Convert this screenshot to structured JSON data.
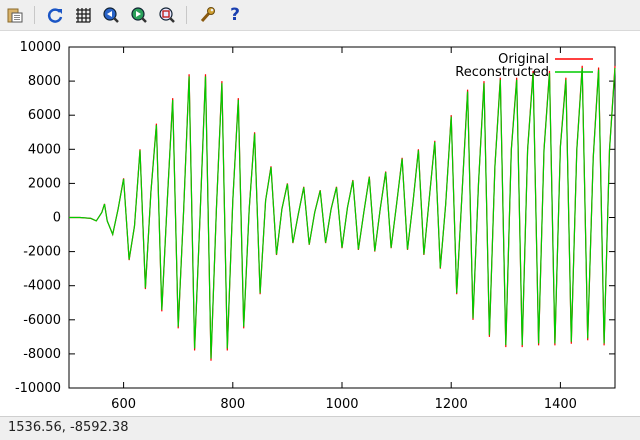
{
  "toolbar": {
    "icons": [
      "copy-to-clipboard-icon",
      "replot-icon",
      "grid-icon",
      "zoom-previous-icon",
      "zoom-next-icon",
      "unzoom-icon",
      "options-icon",
      "help-icon"
    ]
  },
  "status": {
    "coords": "1536.56, -8592.38"
  },
  "chart_data": {
    "type": "line",
    "title": "",
    "xlabel": "",
    "ylabel": "",
    "xlim": [
      500,
      1500
    ],
    "ylim": [
      -10000,
      10000
    ],
    "xticks": [
      600,
      800,
      1000,
      1200,
      1400
    ],
    "yticks": [
      -10000,
      -8000,
      -6000,
      -4000,
      -2000,
      0,
      2000,
      4000,
      6000,
      8000,
      10000
    ],
    "legend_position": "top-right",
    "series": [
      {
        "name": "Original",
        "color": "#ff0000"
      },
      {
        "name": "Reconstructed",
        "color": "#00cc00"
      }
    ],
    "x": [
      500,
      520,
      540,
      550,
      560,
      565,
      570,
      580,
      590,
      600,
      610,
      620,
      630,
      640,
      650,
      660,
      670,
      680,
      690,
      700,
      710,
      720,
      730,
      740,
      750,
      760,
      770,
      780,
      790,
      800,
      810,
      820,
      830,
      840,
      850,
      860,
      870,
      880,
      890,
      900,
      910,
      920,
      930,
      940,
      950,
      960,
      970,
      980,
      990,
      1000,
      1010,
      1020,
      1030,
      1040,
      1050,
      1060,
      1070,
      1080,
      1090,
      1100,
      1110,
      1120,
      1130,
      1140,
      1150,
      1160,
      1170,
      1180,
      1190,
      1200,
      1210,
      1220,
      1230,
      1240,
      1250,
      1260,
      1270,
      1280,
      1290,
      1300,
      1310,
      1320,
      1330,
      1340,
      1350,
      1360,
      1370,
      1380,
      1390,
      1400,
      1410,
      1420,
      1430,
      1440,
      1450,
      1460,
      1470,
      1480,
      1490,
      1500
    ],
    "original": [
      0,
      0,
      -50,
      -200,
      300,
      800,
      -200,
      -1000,
      500,
      2300,
      -2500,
      -500,
      4000,
      -4200,
      1500,
      5500,
      -5500,
      1000,
      7000,
      -6500,
      500,
      8400,
      -7800,
      0,
      8400,
      -8400,
      500,
      8000,
      -7800,
      1000,
      7000,
      -6500,
      500,
      5000,
      -4500,
      1000,
      3000,
      -2200,
      500,
      2000,
      -1500,
      200,
      1800,
      -1600,
      300,
      1600,
      -1500,
      500,
      1800,
      -1800,
      600,
      2200,
      -1900,
      300,
      2400,
      -2000,
      500,
      2700,
      -1800,
      800,
      3500,
      -1900,
      900,
      4000,
      -2200,
      1200,
      4500,
      -3000,
      800,
      6000,
      -4500,
      1500,
      7500,
      -6000,
      2000,
      8000,
      -7000,
      3000,
      8200,
      -7600,
      4000,
      8200,
      -7600,
      4000,
      8600,
      -7500,
      4000,
      8600,
      -7500,
      4200,
      8200,
      -7400,
      4000,
      8900,
      -7200,
      3500,
      8800,
      -7500,
      4000,
      8900,
      -7000
    ]
  }
}
